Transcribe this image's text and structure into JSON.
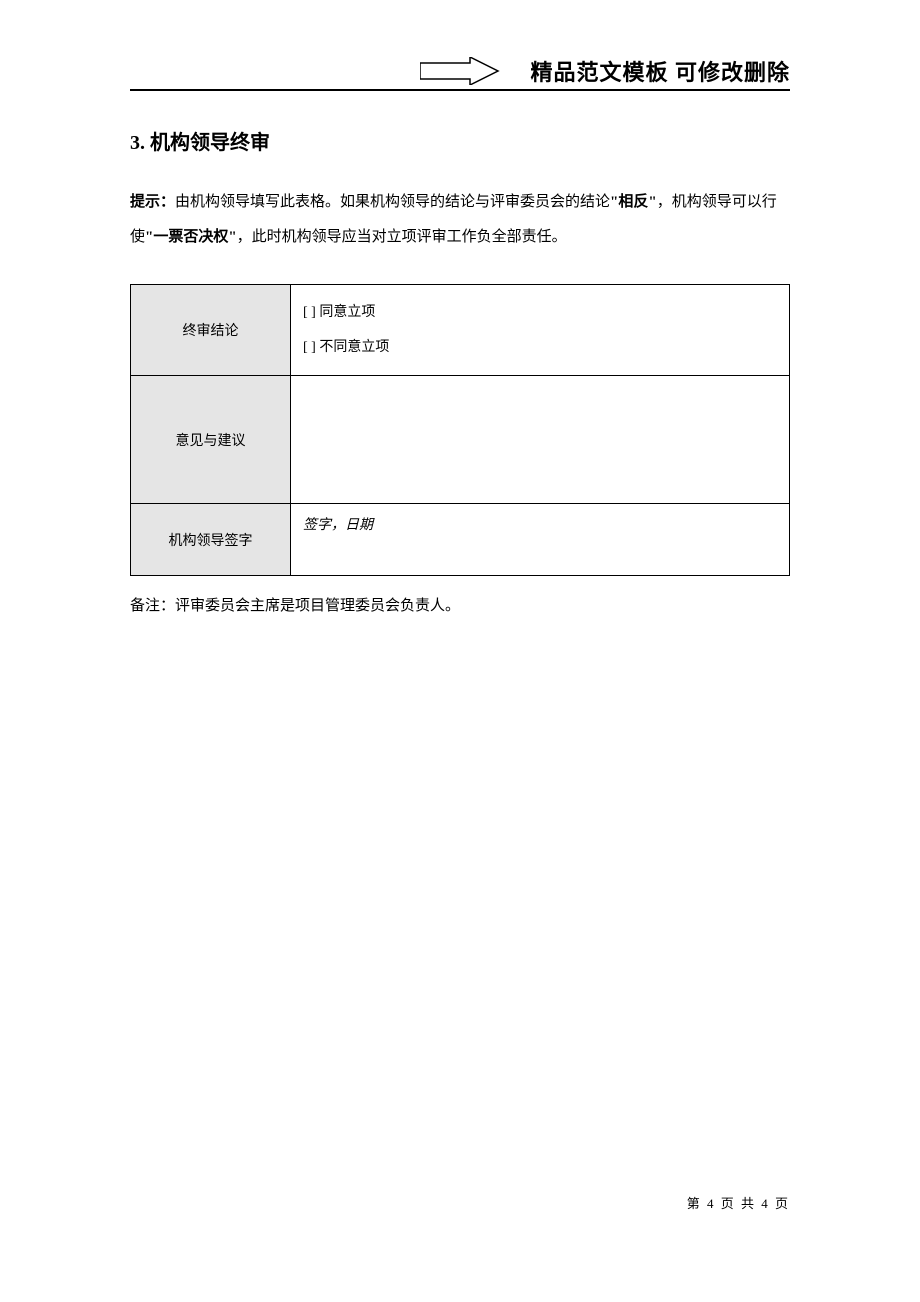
{
  "header": {
    "title": "精品范文模板  可修改删除"
  },
  "section": {
    "number": "3.",
    "title": "机构领导终审"
  },
  "hint": {
    "label": "提示：",
    "text_before_bold1": "由机构领导填写此表格。如果机构领导的结论与评审委员会的结论",
    "bold1": "\"相反\"",
    "text_between": "，机构领导可以行使",
    "bold2": "\"一票否决权\"",
    "text_after": "，此时机构领导应当对立项评审工作负全部责任。"
  },
  "table": {
    "row1": {
      "label": "终审结论",
      "option1": "[    ]  同意立项",
      "option2": "[    ]  不同意立项"
    },
    "row2": {
      "label": "意见与建议"
    },
    "row3": {
      "label": "机构领导签字",
      "content": "签字，日期"
    }
  },
  "footnote": "备注：评审委员会主席是项目管理委员会负责人。",
  "pagination": "第 4 页 共 4 页"
}
